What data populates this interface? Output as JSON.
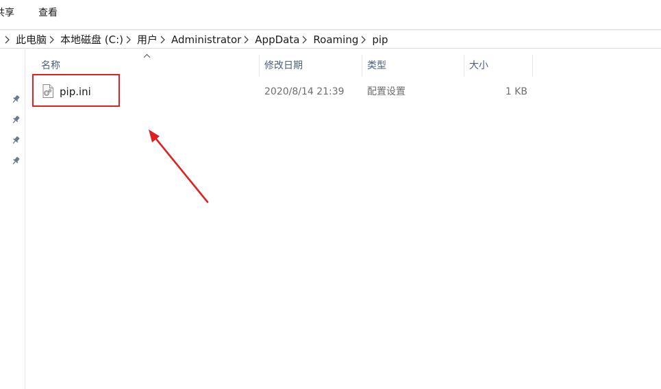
{
  "ribbon": {
    "tabs": [
      {
        "label": "共享"
      },
      {
        "label": "查看"
      }
    ]
  },
  "address_bar": {
    "breadcrumbs": [
      {
        "label": "此电脑"
      },
      {
        "label": "本地磁盘 (C:)"
      },
      {
        "label": "用户"
      },
      {
        "label": "Administrator"
      },
      {
        "label": "AppData"
      },
      {
        "label": "Roaming"
      },
      {
        "label": "pip"
      }
    ]
  },
  "file_list": {
    "columns": {
      "name": "名称",
      "date_modified": "修改日期",
      "type": "类型",
      "size": "大小"
    },
    "sort_column": "name",
    "rows": [
      {
        "name": "pip.ini",
        "date_modified": "2020/8/14 21:39",
        "type": "配置设置",
        "size": "1 KB",
        "icon": "settings-file-icon"
      }
    ]
  },
  "nav_pane": {
    "pinned_count": 4,
    "icon": "pin-icon"
  },
  "annotation": {
    "highlight_color": "#e02020",
    "arrow_color": "#e02020"
  }
}
